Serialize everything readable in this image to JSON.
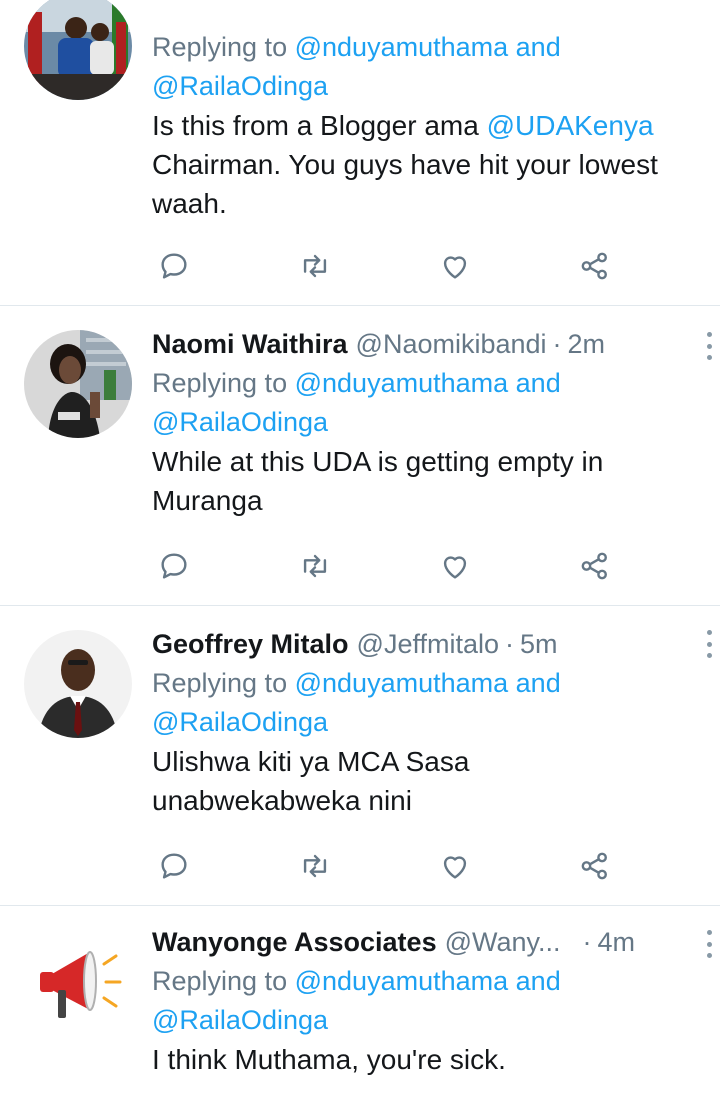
{
  "tweets": [
    {
      "name": "",
      "handle": "",
      "time": "",
      "replying_prefix": "Replying to",
      "replying_user1": "@nduyamuthama",
      "replying_and": "and",
      "replying_user2": "@RailaOdinga",
      "text_a": "Is this from a Blogger ama ",
      "mention": "@UDAKenya",
      "text_b": " Chairman. You guys have hit your lowest waah."
    },
    {
      "name": "Naomi Waithira",
      "handle": "@Naomikibandi",
      "dot": "·",
      "time": "2m",
      "replying_prefix": "Replying to",
      "replying_user1": "@nduyamuthama",
      "replying_and": "and",
      "replying_user2": "@RailaOdinga",
      "text": "While at this UDA is getting empty in Muranga"
    },
    {
      "name": "Geoffrey Mitalo",
      "handle": "@Jeffmitalo",
      "dot": "·",
      "time": "5m",
      "replying_prefix": "Replying to",
      "replying_user1": "@nduyamuthama",
      "replying_and": "and",
      "replying_user2": "@RailaOdinga",
      "text": "Ulishwa kiti ya MCA Sasa unabwekabweka nini"
    },
    {
      "name": "Wanyonge Associates",
      "handle": "@Wany...",
      "dot": "·",
      "time": "4m",
      "replying_prefix": "Replying to",
      "replying_user1": "@nduyamuthama",
      "replying_and": "and",
      "replying_user2": "@RailaOdinga",
      "text": "I think Muthama, you're sick."
    }
  ],
  "icons": {
    "reply": "reply-icon",
    "retweet": "retweet-icon",
    "like": "heart-icon",
    "share": "share-icon",
    "more": "more-vertical-icon"
  },
  "colors": {
    "link": "#1da1f2",
    "secondary": "#657786",
    "icon": "#657786",
    "divider": "#e1e8ed"
  }
}
